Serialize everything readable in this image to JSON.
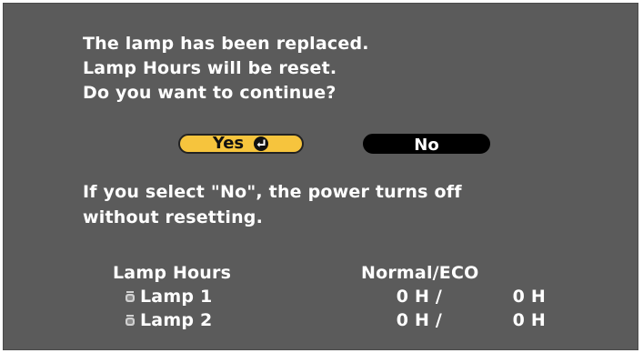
{
  "dialog": {
    "message_lines": [
      "The lamp has been replaced.",
      "Lamp Hours will be reset.",
      "Do you want to continue?"
    ],
    "yes_label": "Yes",
    "yes_icon": "enter-icon",
    "no_label": "No",
    "note_lines": [
      "If you select \"No\", the power turns off",
      "without resetting."
    ]
  },
  "lamp_table": {
    "header_left": "Lamp Hours",
    "header_right": "Normal/ECO",
    "icon": "lamp-icon",
    "rows": [
      {
        "label": "Lamp 1",
        "normal": "0 H /",
        "eco": "0 H"
      },
      {
        "label": "Lamp 2",
        "normal": "0 H /",
        "eco": "0 H"
      }
    ]
  },
  "colors": {
    "background": "#5b5b5b",
    "selected_button": "#f6c43d",
    "unselected_button": "#000000",
    "text": "#ffffff"
  }
}
